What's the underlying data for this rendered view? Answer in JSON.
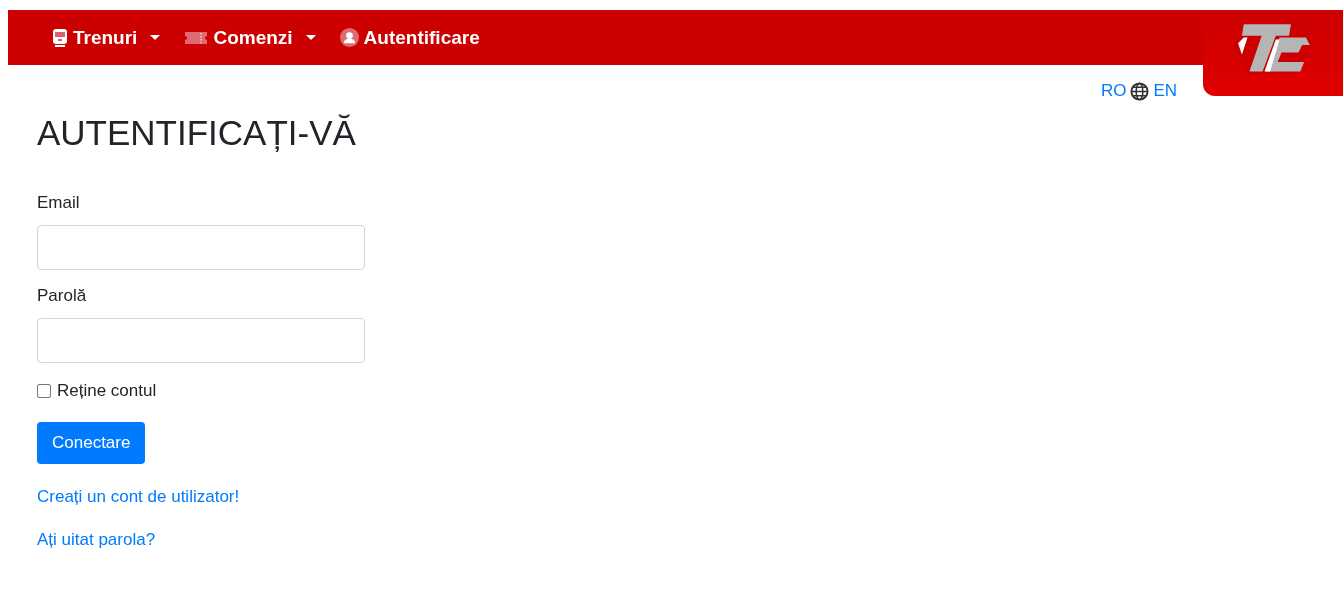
{
  "navbar": {
    "items": [
      {
        "label": "Trenuri",
        "dropdown": true
      },
      {
        "label": "Comenzi",
        "dropdown": true
      },
      {
        "label": "Autentificare",
        "dropdown": false
      }
    ]
  },
  "language": {
    "options": [
      "RO",
      "EN"
    ]
  },
  "title": "AUTENTIFICAȚI-VĂ",
  "form": {
    "fields": [
      {
        "label": "Email"
      },
      {
        "label": "Parolă"
      }
    ],
    "remember": {
      "label": "Reține contul",
      "checked": false
    },
    "submit": "Conectare",
    "links": [
      "Creați un cont de utilizator!",
      "Ați uitat parola?"
    ]
  }
}
